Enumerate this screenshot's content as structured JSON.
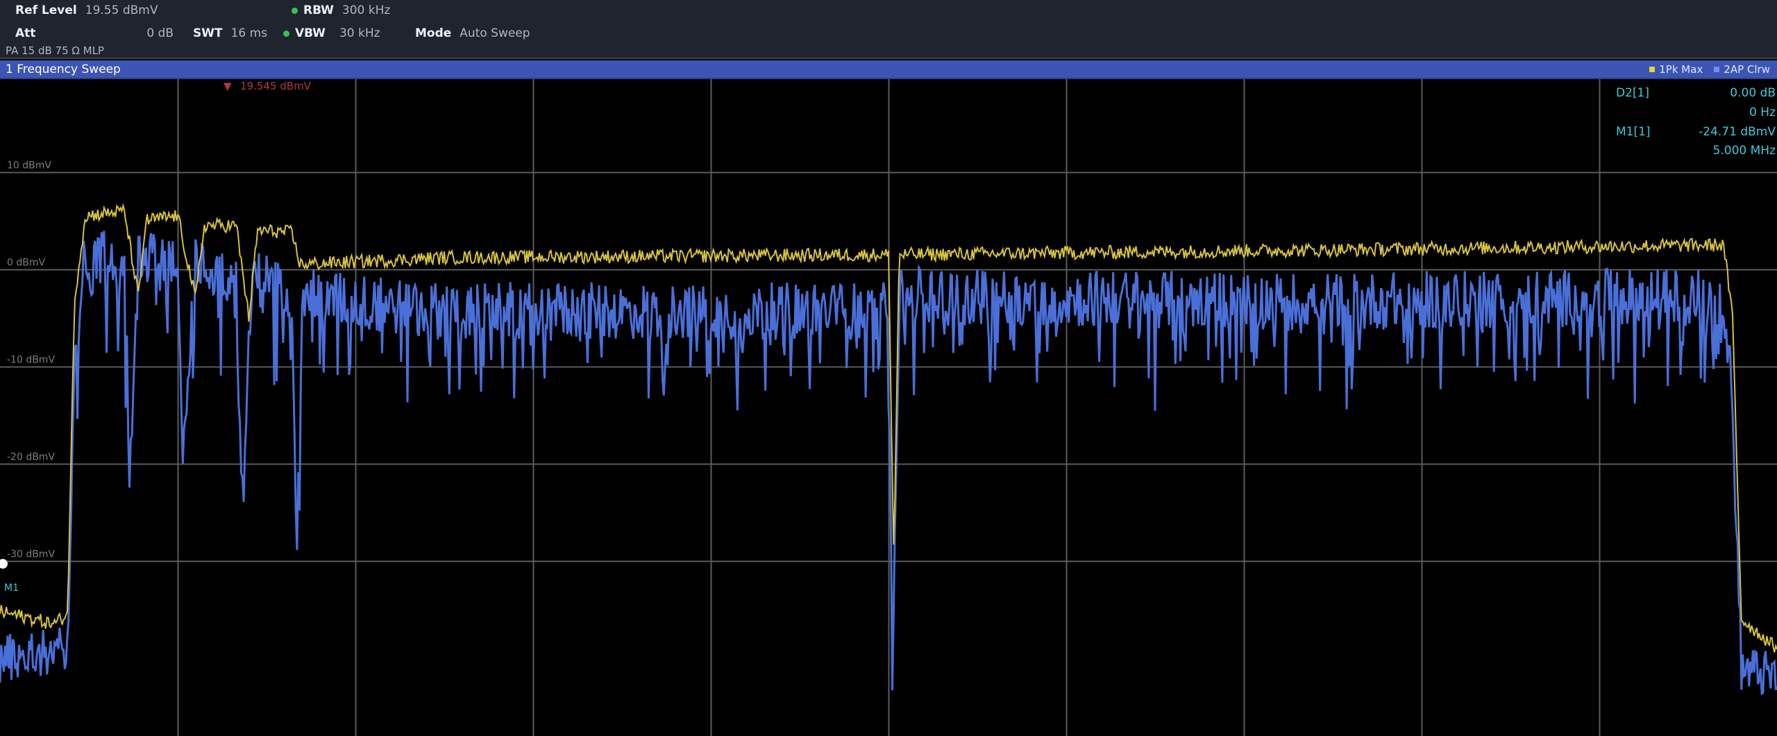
{
  "header": {
    "ref_level_label": "Ref Level",
    "ref_level_value": "19.55 dBmV",
    "att_label": "Att",
    "att_value": "0 dB",
    "swt_label": "SWT",
    "swt_value": "16 ms",
    "rbw_label": "RBW",
    "rbw_value": "300 kHz",
    "vbw_label": "VBW",
    "vbw_value": "30 kHz",
    "mode_label": "Mode",
    "mode_value": "Auto Sweep",
    "line3": "PA 15 dB 75 Ω MLP"
  },
  "window": {
    "title": "1 Frequency Sweep",
    "trace1_legend": "1Pk Max",
    "trace2_legend": "2AP Clrw"
  },
  "markers": {
    "ref_marker_text": "19.545 dBmV",
    "d2_label": "D2[1]",
    "d2_level": "0.00 dB",
    "d2_freq": "0 Hz",
    "m1_label": "M1[1]",
    "m1_level": "-24.71 dBmV",
    "m1_freq": "5.000 MHz",
    "m1_tag": "M1"
  },
  "colors": {
    "max_hold_trace": "#d8c23c",
    "clear_write_trace": "#4a6fd8",
    "grid": "#5c5c5c",
    "marker_text": "#41c9d6",
    "titlebar": "#3c55b4",
    "ref_marker": "#b23a3a"
  },
  "chart_data": {
    "type": "line",
    "ylabel_ticks": [
      "10 dBmV",
      "0 dBmV",
      "-10 dBmV",
      "-20 dBmV",
      "-30 dBmV"
    ],
    "y_ticks": [
      10,
      0,
      -10,
      -20,
      -30
    ],
    "ylim": [
      -48,
      19.55
    ],
    "x_divisions": 10,
    "grid": true,
    "series": [
      {
        "name": "1Pk Max",
        "points": [
          [
            0,
            -35.2
          ],
          [
            2,
            -36.0
          ],
          [
            3,
            -36.5
          ],
          [
            3.8,
            -35.5
          ],
          [
            4.2,
            -3
          ],
          [
            4.8,
            5.5
          ],
          [
            7,
            6.0
          ],
          [
            7.8,
            -3
          ],
          [
            8.2,
            5.0
          ],
          [
            10,
            5.5
          ],
          [
            11,
            -3
          ],
          [
            11.5,
            4.5
          ],
          [
            13.3,
            4.5
          ],
          [
            14,
            -5
          ],
          [
            14.5,
            4
          ],
          [
            16.4,
            3.8
          ],
          [
            16.9,
            0.5
          ],
          [
            25,
            1.2
          ],
          [
            50,
            1.5
          ],
          [
            50.3,
            -30
          ],
          [
            50.6,
            1.5
          ],
          [
            75,
            2.0
          ],
          [
            97,
            2.5
          ],
          [
            97.5,
            -5
          ],
          [
            98,
            -36
          ],
          [
            100,
            -39
          ]
        ]
      },
      {
        "name": "2AP Clrw",
        "points": [
          [
            0,
            -40
          ],
          [
            3.8,
            -39
          ],
          [
            4.2,
            -10
          ],
          [
            4.8,
            1
          ],
          [
            7,
            -1
          ],
          [
            7.3,
            -22
          ],
          [
            7.8,
            0
          ],
          [
            10,
            -1
          ],
          [
            10.3,
            -20
          ],
          [
            11,
            -1
          ],
          [
            13.3,
            -2
          ],
          [
            13.6,
            -27
          ],
          [
            14.2,
            -2
          ],
          [
            16.4,
            -3
          ],
          [
            16.7,
            -29
          ],
          [
            17,
            -4
          ],
          [
            25,
            -5.5
          ],
          [
            50,
            -5.5
          ],
          [
            50.2,
            -42
          ],
          [
            50.6,
            -4
          ],
          [
            75,
            -4.5
          ],
          [
            97,
            -4
          ],
          [
            97.5,
            -15
          ],
          [
            98,
            -41
          ],
          [
            100,
            -42
          ]
        ]
      }
    ]
  }
}
